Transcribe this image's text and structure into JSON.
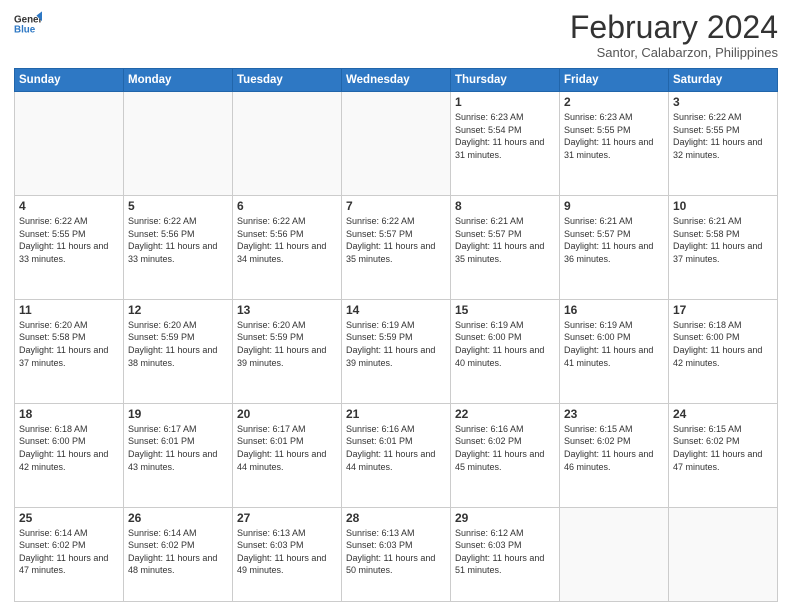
{
  "header": {
    "logo_line1": "General",
    "logo_line2": "Blue",
    "month_title": "February 2024",
    "subtitle": "Santor, Calabarzon, Philippines"
  },
  "weekdays": [
    "Sunday",
    "Monday",
    "Tuesday",
    "Wednesday",
    "Thursday",
    "Friday",
    "Saturday"
  ],
  "weeks": [
    [
      {
        "day": "",
        "info": ""
      },
      {
        "day": "",
        "info": ""
      },
      {
        "day": "",
        "info": ""
      },
      {
        "day": "",
        "info": ""
      },
      {
        "day": "1",
        "info": "Sunrise: 6:23 AM\nSunset: 5:54 PM\nDaylight: 11 hours and 31 minutes."
      },
      {
        "day": "2",
        "info": "Sunrise: 6:23 AM\nSunset: 5:55 PM\nDaylight: 11 hours and 31 minutes."
      },
      {
        "day": "3",
        "info": "Sunrise: 6:22 AM\nSunset: 5:55 PM\nDaylight: 11 hours and 32 minutes."
      }
    ],
    [
      {
        "day": "4",
        "info": "Sunrise: 6:22 AM\nSunset: 5:55 PM\nDaylight: 11 hours and 33 minutes."
      },
      {
        "day": "5",
        "info": "Sunrise: 6:22 AM\nSunset: 5:56 PM\nDaylight: 11 hours and 33 minutes."
      },
      {
        "day": "6",
        "info": "Sunrise: 6:22 AM\nSunset: 5:56 PM\nDaylight: 11 hours and 34 minutes."
      },
      {
        "day": "7",
        "info": "Sunrise: 6:22 AM\nSunset: 5:57 PM\nDaylight: 11 hours and 35 minutes."
      },
      {
        "day": "8",
        "info": "Sunrise: 6:21 AM\nSunset: 5:57 PM\nDaylight: 11 hours and 35 minutes."
      },
      {
        "day": "9",
        "info": "Sunrise: 6:21 AM\nSunset: 5:57 PM\nDaylight: 11 hours and 36 minutes."
      },
      {
        "day": "10",
        "info": "Sunrise: 6:21 AM\nSunset: 5:58 PM\nDaylight: 11 hours and 37 minutes."
      }
    ],
    [
      {
        "day": "11",
        "info": "Sunrise: 6:20 AM\nSunset: 5:58 PM\nDaylight: 11 hours and 37 minutes."
      },
      {
        "day": "12",
        "info": "Sunrise: 6:20 AM\nSunset: 5:59 PM\nDaylight: 11 hours and 38 minutes."
      },
      {
        "day": "13",
        "info": "Sunrise: 6:20 AM\nSunset: 5:59 PM\nDaylight: 11 hours and 39 minutes."
      },
      {
        "day": "14",
        "info": "Sunrise: 6:19 AM\nSunset: 5:59 PM\nDaylight: 11 hours and 39 minutes."
      },
      {
        "day": "15",
        "info": "Sunrise: 6:19 AM\nSunset: 6:00 PM\nDaylight: 11 hours and 40 minutes."
      },
      {
        "day": "16",
        "info": "Sunrise: 6:19 AM\nSunset: 6:00 PM\nDaylight: 11 hours and 41 minutes."
      },
      {
        "day": "17",
        "info": "Sunrise: 6:18 AM\nSunset: 6:00 PM\nDaylight: 11 hours and 42 minutes."
      }
    ],
    [
      {
        "day": "18",
        "info": "Sunrise: 6:18 AM\nSunset: 6:00 PM\nDaylight: 11 hours and 42 minutes."
      },
      {
        "day": "19",
        "info": "Sunrise: 6:17 AM\nSunset: 6:01 PM\nDaylight: 11 hours and 43 minutes."
      },
      {
        "day": "20",
        "info": "Sunrise: 6:17 AM\nSunset: 6:01 PM\nDaylight: 11 hours and 44 minutes."
      },
      {
        "day": "21",
        "info": "Sunrise: 6:16 AM\nSunset: 6:01 PM\nDaylight: 11 hours and 44 minutes."
      },
      {
        "day": "22",
        "info": "Sunrise: 6:16 AM\nSunset: 6:02 PM\nDaylight: 11 hours and 45 minutes."
      },
      {
        "day": "23",
        "info": "Sunrise: 6:15 AM\nSunset: 6:02 PM\nDaylight: 11 hours and 46 minutes."
      },
      {
        "day": "24",
        "info": "Sunrise: 6:15 AM\nSunset: 6:02 PM\nDaylight: 11 hours and 47 minutes."
      }
    ],
    [
      {
        "day": "25",
        "info": "Sunrise: 6:14 AM\nSunset: 6:02 PM\nDaylight: 11 hours and 47 minutes."
      },
      {
        "day": "26",
        "info": "Sunrise: 6:14 AM\nSunset: 6:02 PM\nDaylight: 11 hours and 48 minutes."
      },
      {
        "day": "27",
        "info": "Sunrise: 6:13 AM\nSunset: 6:03 PM\nDaylight: 11 hours and 49 minutes."
      },
      {
        "day": "28",
        "info": "Sunrise: 6:13 AM\nSunset: 6:03 PM\nDaylight: 11 hours and 50 minutes."
      },
      {
        "day": "29",
        "info": "Sunrise: 6:12 AM\nSunset: 6:03 PM\nDaylight: 11 hours and 51 minutes."
      },
      {
        "day": "",
        "info": ""
      },
      {
        "day": "",
        "info": ""
      }
    ]
  ]
}
